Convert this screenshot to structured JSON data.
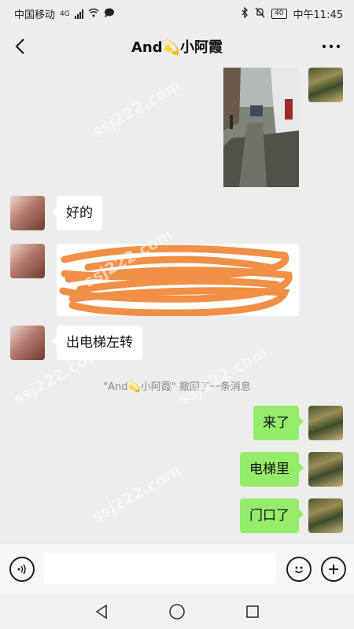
{
  "status_bar": {
    "carrier": "中国移动",
    "network": "4G",
    "battery": "40",
    "time": "中午11:45"
  },
  "header": {
    "title": "And💫小阿霞"
  },
  "messages": [
    {
      "side": "left",
      "text": "好的"
    },
    {
      "side": "left",
      "text": "出电梯左转"
    },
    {
      "side": "right",
      "text": "来了"
    },
    {
      "side": "right",
      "text": "电梯里"
    },
    {
      "side": "right",
      "text": "门口了"
    }
  ],
  "system_message": "\"And💫小阿霞\" 撤回了一条消息",
  "watermark": "ssj222.com",
  "icons": {
    "back": "back-arrow-icon",
    "more": "more-icon",
    "voice": "voice-icon",
    "emoji": "emoji-icon",
    "plus": "plus-icon"
  },
  "colors": {
    "my_bubble": "#95ec69",
    "friend_bubble": "#ffffff",
    "background": "#ededed",
    "scribble": "#f08a3c"
  }
}
